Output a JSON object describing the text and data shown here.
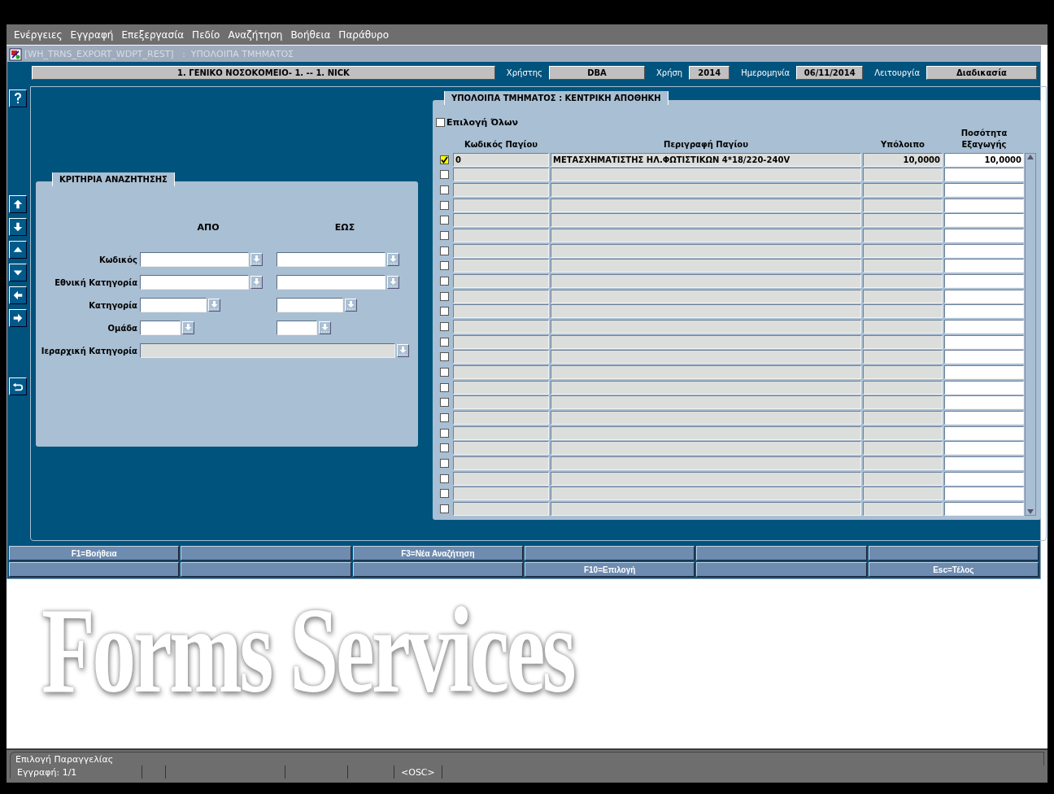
{
  "menu": [
    "Ενέργειες",
    "Εγγραφή",
    "Επεξεργασία",
    "Πεδίο",
    "Αναζήτηση",
    "Βοήθεια",
    "Παράθυρο"
  ],
  "window": {
    "title": "[WH_TRNS_EXPORT_WDPT_REST]   :  ΥΠΟΛΟΙΠΑ ΤΜΗΜΑΤΟΣ"
  },
  "header": {
    "organization": "1. ΓΕΝΙΚΟ ΝΟΣΟΚΟΜΕΙΟ- 1. -- 1. NICK",
    "fields": [
      {
        "label": "Χρήστης",
        "value": "DBA"
      },
      {
        "label": "Χρήση",
        "value": "2014"
      },
      {
        "label": "Ημερομηνία",
        "value": "06/11/2014"
      },
      {
        "label": "Λειτουργία",
        "value": "Διαδικασία"
      }
    ]
  },
  "toolbar": [
    {
      "kind": "help"
    },
    {
      "kind": "gap"
    },
    {
      "kind": "first"
    },
    {
      "kind": "last"
    },
    {
      "kind": "prev"
    },
    {
      "kind": "next"
    },
    {
      "kind": "left"
    },
    {
      "kind": "right"
    },
    {
      "kind": "gap"
    },
    {
      "kind": "undo"
    }
  ],
  "criteria": {
    "title": "ΚΡΙΤΗΡΙΑ ΑΝΑΖΗΤΗΣΗΣ",
    "from_label": "ΑΠΟ",
    "to_label": "ΕΩΣ",
    "rows": [
      {
        "label": "Κωδικός",
        "kind": "range",
        "disabled": false
      },
      {
        "label": "Εθνική Κατηγορία",
        "kind": "range",
        "disabled": false
      },
      {
        "label": "Κατηγορία",
        "kind": "range",
        "disabled": false
      },
      {
        "label": "Ομάδα",
        "kind": "range",
        "disabled": false
      },
      {
        "label": "Ιεραρχική Κατηγορία",
        "kind": "single",
        "disabled": true
      }
    ]
  },
  "table": {
    "title": "ΥΠΟΛΟΙΠΑ ΤΜΗΜΑΤΟΣ : ΚΕΝΤΡΙΚΗ ΑΠΟΘΗΚΗ",
    "select_all": {
      "label": "Επιλογή Όλων",
      "checked": false
    },
    "columns": [
      "Κωδικός Παγίου",
      "Περιγραφή Παγίου",
      "Υπόλοιπο",
      "Ποσότητα Εξαγωγής"
    ],
    "rows": [
      {
        "checked": true,
        "current": true,
        "code": "0",
        "description": "ΜΕΤΑΣΧΗΜΑΤΙΣΤΗΣ ΗΛ.ΦΩΤΙΣΤΙΚΩΝ 4*18/220-240V",
        "balance": "10,0000",
        "quantity": "10,0000"
      },
      {
        "checked": false,
        "current": false
      },
      {
        "checked": false,
        "current": false
      },
      {
        "checked": false,
        "current": false
      },
      {
        "checked": false,
        "current": false
      },
      {
        "checked": false,
        "current": false
      },
      {
        "checked": false,
        "current": false
      },
      {
        "checked": false,
        "current": false
      },
      {
        "checked": false,
        "current": false
      },
      {
        "checked": false,
        "current": false
      },
      {
        "checked": false,
        "current": false
      },
      {
        "checked": false,
        "current": false
      },
      {
        "checked": false,
        "current": false
      },
      {
        "checked": false,
        "current": false
      },
      {
        "checked": false,
        "current": false
      },
      {
        "checked": false,
        "current": false
      },
      {
        "checked": false,
        "current": false
      },
      {
        "checked": false,
        "current": false
      },
      {
        "checked": false,
        "current": false
      },
      {
        "checked": false,
        "current": false
      },
      {
        "checked": false,
        "current": false
      },
      {
        "checked": false,
        "current": false
      },
      {
        "checked": false,
        "current": false
      },
      {
        "checked": false,
        "current": false
      }
    ]
  },
  "function_keys": [
    {
      "kind": "key",
      "label": "F1=Βοήθεια"
    },
    {
      "kind": "blank"
    },
    {
      "kind": "key",
      "label": "F3=Νέα Αναζήτηση"
    },
    {
      "kind": "blank"
    },
    {
      "kind": "blank"
    },
    {
      "kind": "blank"
    },
    {
      "kind": "blank"
    },
    {
      "kind": "blank"
    },
    {
      "kind": "blank"
    },
    {
      "kind": "key",
      "label": "F10=Επιλογή"
    },
    {
      "kind": "blank"
    },
    {
      "kind": "key",
      "label": "Esc=Τέλος"
    }
  ],
  "background_logo": "Forms Services",
  "status_bar": {
    "message": "Επιλογή Παραγγελίας",
    "segments": [
      {
        "kind": "text",
        "text": "Εγγραφή: 1/1"
      },
      {
        "kind": "blank"
      },
      {
        "kind": "blank"
      },
      {
        "kind": "blank"
      },
      {
        "kind": "blank"
      },
      {
        "kind": "text",
        "text": "<OSC>"
      }
    ]
  }
}
